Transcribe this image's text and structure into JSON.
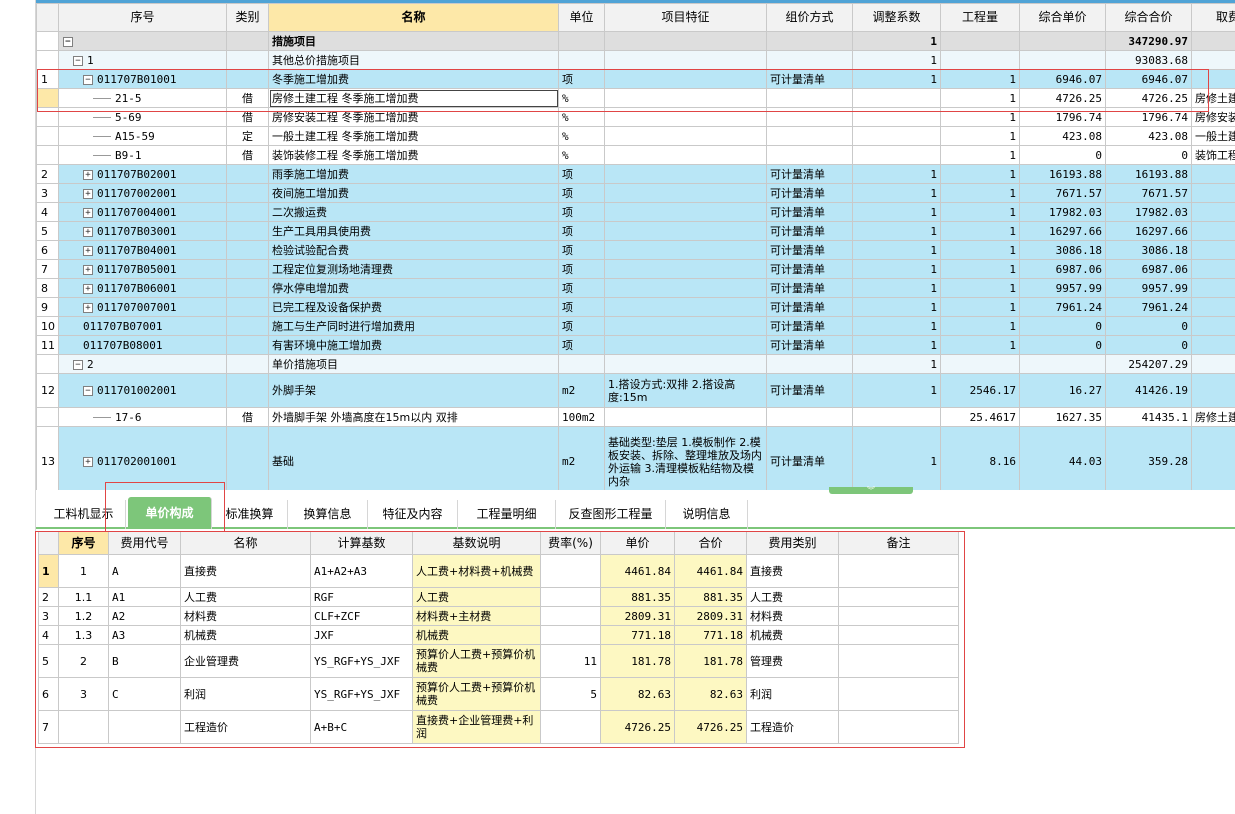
{
  "top_grid": {
    "headers": [
      "序号",
      "类别",
      "名称",
      "单位",
      "项目特征",
      "组价方式",
      "调整系数",
      "工程量",
      "综合单价",
      "综合合价",
      "取费专"
    ],
    "rows": [
      {
        "rn": "",
        "code": "",
        "cat": "",
        "name": "措施项目",
        "unit": "",
        "feat": "",
        "method": "",
        "coef": "1",
        "qty": "",
        "price": "",
        "total": "347290.97",
        "fee": "",
        "style": "grey",
        "tog": "−",
        "indent": 0
      },
      {
        "rn": "",
        "code": "1",
        "cat": "",
        "name": "其他总价措施项目",
        "unit": "",
        "feat": "",
        "method": "",
        "coef": "1",
        "qty": "",
        "price": "",
        "total": "93083.68",
        "fee": "",
        "style": "light",
        "tog": "−",
        "indent": 1
      },
      {
        "rn": "1",
        "code": "011707B01001",
        "cat": "",
        "name": "冬季施工增加费",
        "unit": "项",
        "feat": "",
        "method": "可计量清单",
        "coef": "1",
        "qty": "1",
        "price": "6946.07",
        "total": "6946.07",
        "fee": "",
        "style": "blue",
        "tog": "−",
        "indent": 2
      },
      {
        "rn": "",
        "code": "21-5",
        "cat": "借",
        "name": "房修土建工程 冬季施工增加费",
        "unit": "%",
        "feat": "",
        "method": "",
        "coef": "",
        "qty": "1",
        "price": "4726.25",
        "total": "4726.25",
        "fee": "房修土建",
        "style": "white",
        "tog": "",
        "indent": 3,
        "selected": true
      },
      {
        "rn": "",
        "code": "5-69",
        "cat": "借",
        "name": "房修安装工程 冬季施工增加费",
        "unit": "%",
        "feat": "",
        "method": "",
        "coef": "",
        "qty": "1",
        "price": "1796.74",
        "total": "1796.74",
        "fee": "房修安装",
        "style": "white",
        "tog": "",
        "indent": 3
      },
      {
        "rn": "",
        "code": "A15-59",
        "cat": "定",
        "name": "一般土建工程 冬季施工增加费",
        "unit": "%",
        "feat": "",
        "method": "",
        "coef": "",
        "qty": "1",
        "price": "423.08",
        "total": "423.08",
        "fee": "一般土建",
        "style": "white",
        "tog": "",
        "indent": 3
      },
      {
        "rn": "",
        "code": "B9-1",
        "cat": "借",
        "name": "装饰装修工程 冬季施工增加费",
        "unit": "%",
        "feat": "",
        "method": "",
        "coef": "",
        "qty": "1",
        "price": "0",
        "total": "0",
        "fee": "装饰工程",
        "style": "white",
        "tog": "",
        "indent": 3
      },
      {
        "rn": "2",
        "code": "011707B02001",
        "cat": "",
        "name": "雨季施工增加费",
        "unit": "项",
        "feat": "",
        "method": "可计量清单",
        "coef": "1",
        "qty": "1",
        "price": "16193.88",
        "total": "16193.88",
        "fee": "",
        "style": "blue",
        "tog": "+",
        "indent": 2
      },
      {
        "rn": "3",
        "code": "011707002001",
        "cat": "",
        "name": "夜间施工增加费",
        "unit": "项",
        "feat": "",
        "method": "可计量清单",
        "coef": "1",
        "qty": "1",
        "price": "7671.57",
        "total": "7671.57",
        "fee": "",
        "style": "blue",
        "tog": "+",
        "indent": 2
      },
      {
        "rn": "4",
        "code": "011707004001",
        "cat": "",
        "name": "二次搬运费",
        "unit": "项",
        "feat": "",
        "method": "可计量清单",
        "coef": "1",
        "qty": "1",
        "price": "17982.03",
        "total": "17982.03",
        "fee": "",
        "style": "blue",
        "tog": "+",
        "indent": 2
      },
      {
        "rn": "5",
        "code": "011707B03001",
        "cat": "",
        "name": "生产工具用具使用费",
        "unit": "项",
        "feat": "",
        "method": "可计量清单",
        "coef": "1",
        "qty": "1",
        "price": "16297.66",
        "total": "16297.66",
        "fee": "",
        "style": "blue",
        "tog": "+",
        "indent": 2
      },
      {
        "rn": "6",
        "code": "011707B04001",
        "cat": "",
        "name": "检验试验配合费",
        "unit": "项",
        "feat": "",
        "method": "可计量清单",
        "coef": "1",
        "qty": "1",
        "price": "3086.18",
        "total": "3086.18",
        "fee": "",
        "style": "blue",
        "tog": "+",
        "indent": 2
      },
      {
        "rn": "7",
        "code": "011707B05001",
        "cat": "",
        "name": "工程定位复测场地清理费",
        "unit": "项",
        "feat": "",
        "method": "可计量清单",
        "coef": "1",
        "qty": "1",
        "price": "6987.06",
        "total": "6987.06",
        "fee": "",
        "style": "blue",
        "tog": "+",
        "indent": 2
      },
      {
        "rn": "8",
        "code": "011707B06001",
        "cat": "",
        "name": "停水停电增加费",
        "unit": "项",
        "feat": "",
        "method": "可计量清单",
        "coef": "1",
        "qty": "1",
        "price": "9957.99",
        "total": "9957.99",
        "fee": "",
        "style": "blue",
        "tog": "+",
        "indent": 2
      },
      {
        "rn": "9",
        "code": "011707007001",
        "cat": "",
        "name": "已完工程及设备保护费",
        "unit": "项",
        "feat": "",
        "method": "可计量清单",
        "coef": "1",
        "qty": "1",
        "price": "7961.24",
        "total": "7961.24",
        "fee": "",
        "style": "blue",
        "tog": "+",
        "indent": 2
      },
      {
        "rn": "10",
        "code": "011707B07001",
        "cat": "",
        "name": "施工与生产同时进行增加费用",
        "unit": "项",
        "feat": "",
        "method": "可计量清单",
        "coef": "1",
        "qty": "1",
        "price": "0",
        "total": "0",
        "fee": "",
        "style": "blue",
        "tog": "",
        "indent": 2
      },
      {
        "rn": "11",
        "code": "011707B08001",
        "cat": "",
        "name": "有害环境中施工增加费",
        "unit": "项",
        "feat": "",
        "method": "可计量清单",
        "coef": "1",
        "qty": "1",
        "price": "0",
        "total": "0",
        "fee": "",
        "style": "blue",
        "tog": "",
        "indent": 2
      },
      {
        "rn": "",
        "code": "2",
        "cat": "",
        "name": "单价措施项目",
        "unit": "",
        "feat": "",
        "method": "",
        "coef": "1",
        "qty": "",
        "price": "",
        "total": "254207.29",
        "fee": "",
        "style": "light",
        "tog": "−",
        "indent": 1
      },
      {
        "rn": "12",
        "code": "011701002001",
        "cat": "",
        "name": "外脚手架",
        "unit": "m2",
        "feat": "1.搭设方式:双排\n2.搭设高度:15m",
        "method": "可计量清单",
        "coef": "1",
        "qty": "2546.17",
        "price": "16.27",
        "total": "41426.19",
        "fee": "",
        "style": "blue",
        "tog": "−",
        "indent": 2,
        "tall": 34
      },
      {
        "rn": "",
        "code": "17-6",
        "cat": "借",
        "name": "外墙脚手架 外墙高度在15m以内 双排",
        "unit": "100m2",
        "feat": "",
        "method": "",
        "coef": "",
        "qty": "25.4617",
        "price": "1627.35",
        "total": "41435.1",
        "fee": "房修土建",
        "style": "white",
        "tog": "",
        "indent": 3
      },
      {
        "rn": "13",
        "code": "011702001001",
        "cat": "",
        "name": "基础",
        "unit": "m2",
        "feat": "基础类型:垫层\n1.模板制作\n2.模板安装、拆除、整理堆放及场内外运输\n3.清理模板粘结物及模内杂",
        "method": "可计量清单",
        "coef": "1",
        "qty": "8.16",
        "price": "44.03",
        "total": "359.28",
        "fee": "",
        "style": "blue",
        "tog": "+",
        "indent": 2,
        "tall": 70
      }
    ]
  },
  "tabs": [
    "工料机显示",
    "单价构成",
    "标准换算",
    "换算信息",
    "特征及内容",
    "工程量明细",
    "反查图形工程量",
    "说明信息"
  ],
  "active_tab": "单价构成",
  "bottom_grid": {
    "headers": [
      "",
      "序号",
      "费用代号",
      "名称",
      "计算基数",
      "基数说明",
      "费率(%)",
      "单价",
      "合价",
      "费用类别",
      "备注"
    ],
    "rows": [
      {
        "rn": "1",
        "seq": "1",
        "code": "A",
        "name": "直接费",
        "base": "A1+A2+A3",
        "desc": "人工费+材料费+机械费",
        "rate": "",
        "price": "4461.84",
        "total": "4461.84",
        "type": "直接费",
        "note": ""
      },
      {
        "rn": "2",
        "seq": "1.1",
        "code": "A1",
        "name": "人工费",
        "base": "RGF",
        "desc": "人工费",
        "rate": "",
        "price": "881.35",
        "total": "881.35",
        "type": "人工费",
        "note": ""
      },
      {
        "rn": "3",
        "seq": "1.2",
        "code": "A2",
        "name": "材料费",
        "base": "CLF+ZCF",
        "desc": "材料费+主材费",
        "rate": "",
        "price": "2809.31",
        "total": "2809.31",
        "type": "材料费",
        "note": ""
      },
      {
        "rn": "4",
        "seq": "1.3",
        "code": "A3",
        "name": "机械费",
        "base": "JXF",
        "desc": "机械费",
        "rate": "",
        "price": "771.18",
        "total": "771.18",
        "type": "机械费",
        "note": ""
      },
      {
        "rn": "5",
        "seq": "2",
        "code": "B",
        "name": "企业管理费",
        "base": "YS_RGF+YS_JXF",
        "desc": "预算价人工费+预算价机械费",
        "rate": "11",
        "price": "181.78",
        "total": "181.78",
        "type": "管理费",
        "note": ""
      },
      {
        "rn": "6",
        "seq": "3",
        "code": "C",
        "name": "利润",
        "base": "YS_RGF+YS_JXF",
        "desc": "预算价人工费+预算价机械费",
        "rate": "5",
        "price": "82.63",
        "total": "82.63",
        "type": "利润",
        "note": ""
      },
      {
        "rn": "7",
        "seq": "",
        "code": "",
        "name": "工程造价",
        "base": "A+B+C",
        "desc": "直接费+企业管理费+利润",
        "rate": "",
        "price": "4726.25",
        "total": "4726.25",
        "type": "工程造价",
        "note": ""
      }
    ]
  },
  "colors": {
    "row_blue": "#b9e6f6",
    "tab_green": "#7dc67a",
    "header_yellow": "#fde8a8",
    "cell_yellow": "#fdf8c2",
    "annotation_red": "#e04545"
  }
}
